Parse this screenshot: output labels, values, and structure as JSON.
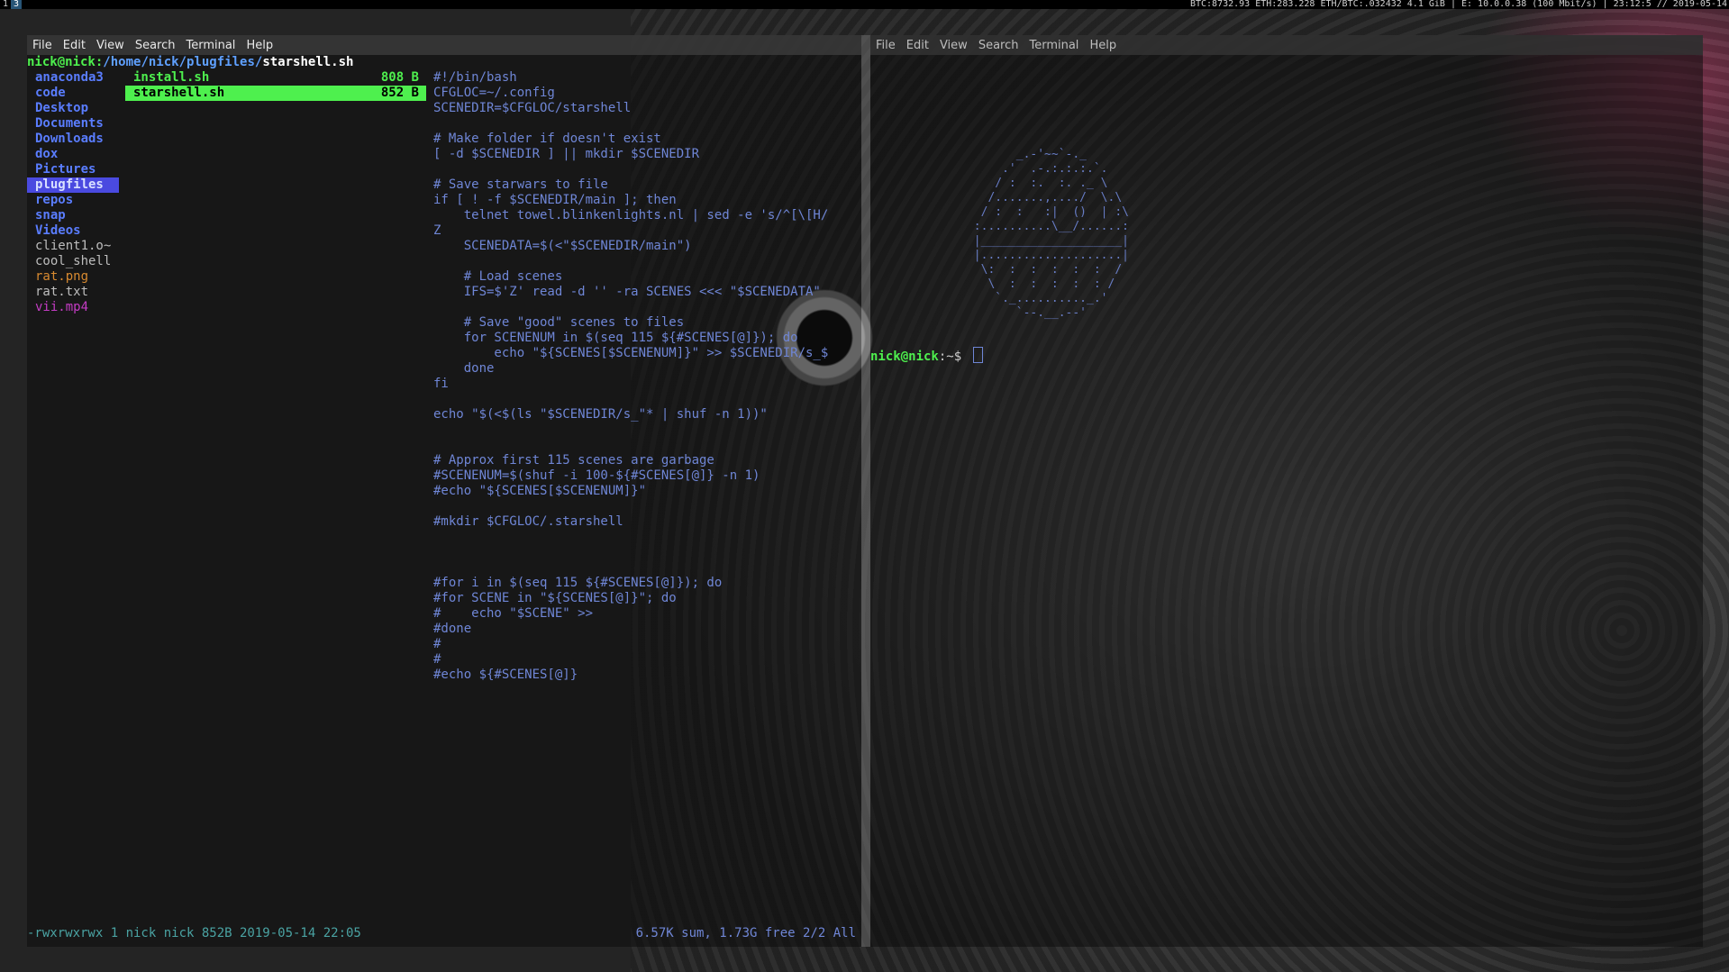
{
  "topbar": {
    "workspaces": [
      "1",
      "3"
    ],
    "active_workspace": "3",
    "status": "BTC:8732.93  ETH:283.228  ETH/BTC:.032432  4.1 GiB | E: 10.0.0.38 (100 Mbit/s) | 23:12:5 // 2019-05-14"
  },
  "menu": [
    "File",
    "Edit",
    "View",
    "Search",
    "Terminal",
    "Help"
  ],
  "left": {
    "header": {
      "user": "nick@nick:",
      "path": "/home/nick/plugfiles/",
      "file": "starshell.sh"
    },
    "dirs": [
      {
        "name": "anaconda3",
        "kind": "dir"
      },
      {
        "name": "code",
        "kind": "dir"
      },
      {
        "name": "Desktop",
        "kind": "dir"
      },
      {
        "name": "Documents",
        "kind": "dir"
      },
      {
        "name": "Downloads",
        "kind": "dir"
      },
      {
        "name": "dox",
        "kind": "dir"
      },
      {
        "name": "Pictures",
        "kind": "dir"
      },
      {
        "name": "plugfiles",
        "kind": "dir-selected"
      },
      {
        "name": "repos",
        "kind": "dir"
      },
      {
        "name": "snap",
        "kind": "dir"
      },
      {
        "name": "Videos",
        "kind": "dir"
      },
      {
        "name": "client1.o~",
        "kind": "plain"
      },
      {
        "name": "cool_shell",
        "kind": "plain"
      },
      {
        "name": "rat.png",
        "kind": "img"
      },
      {
        "name": "rat.txt",
        "kind": "plain"
      },
      {
        "name": "vii.mp4",
        "kind": "vid"
      }
    ],
    "files": [
      {
        "name": "install.sh",
        "size": "808 B"
      },
      {
        "name": "starshell.sh",
        "size": "852 B",
        "selected": true
      }
    ],
    "preview": [
      "#!/bin/bash",
      "CFGLOC=~/.config",
      "SCENEDIR=$CFGLOC/starshell",
      "",
      "# Make folder if doesn't exist",
      "[ -d $SCENEDIR ] || mkdir $SCENEDIR",
      "",
      "# Save starwars to file",
      "if [ ! -f $SCENEDIR/main ]; then",
      "    telnet towel.blinkenlights.nl | sed -e 's/^[\\[H/",
      "Z",
      "    SCENEDATA=$(<\"$SCENEDIR/main\")",
      "",
      "    # Load scenes",
      "    IFS=$'Z' read -d '' -ra SCENES <<< \"$SCENEDATA\"",
      "",
      "    # Save \"good\" scenes to files",
      "    for SCENENUM in $(seq 115 ${#SCENES[@]}); do",
      "        echo \"${SCENES[$SCENENUM]}\" >> $SCENEDIR/s_$",
      "    done",
      "fi",
      "",
      "echo \"$(<$(ls \"$SCENEDIR/s_\"* | shuf -n 1))\"",
      "",
      "",
      "# Approx first 115 scenes are garbage",
      "#SCENENUM=$(shuf -i 100-${#SCENES[@]} -n 1)",
      "#echo \"${SCENES[$SCENENUM]}\"",
      "",
      "#mkdir $CFGLOC/.starshell",
      "",
      "",
      "",
      "#for i in $(seq 115 ${#SCENES[@]}); do",
      "#for SCENE in \"${SCENES[@]}\"; do",
      "#    echo \"$SCENE\" >>",
      "#done",
      "#",
      "#",
      "#echo ${#SCENES[@]}"
    ],
    "footer_left": "-rwxrwxrwx 1 nick nick 852B 2019-05-14 22:05",
    "footer_right": "6.57K sum, 1.73G free  2/2  All"
  },
  "right": {
    "ascii_art": "             _.-'~~`-._\n           .'  .-.:.:.:.`.\n          / :  :.  :. ._ \\\n         /.......,..../  \\.\\\n        / :  :   :|  ()  | :\\\n       :..........\\__/......:\n       |____________________|\n       |....................|\n        \\:  :  :  :  :  :  /\n         \\  :  :  :  :  : /\n          `._.........._.'\n             `--.__.--'",
    "prompt_user": "nick@nick",
    "prompt_rest": ":~$ "
  }
}
